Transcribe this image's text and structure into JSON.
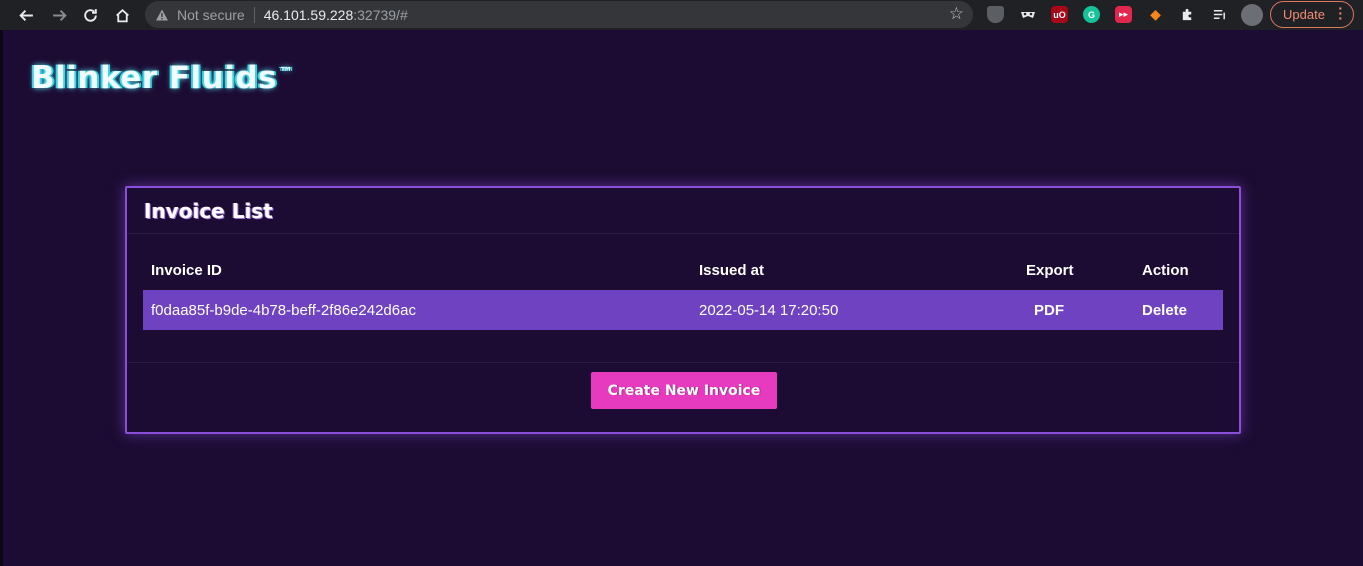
{
  "browser": {
    "not_secure_label": "Not secure",
    "url_host": "46.101.59.228",
    "url_rest": ":32739/#",
    "update_label": "Update",
    "extensions": [
      "shield-extension-icon",
      "mask-extension-icon",
      "ublock-icon",
      "grammarly-icon",
      "youtube-extension-icon",
      "metamask-fox-icon",
      "puzzle-extensions-icon",
      "reading-list-icon",
      "profile-avatar"
    ]
  },
  "app": {
    "logo_text": "Blinker Fluids",
    "logo_tm": "™"
  },
  "invoice_card": {
    "title": "Invoice List",
    "headers": {
      "invoice_id": "Invoice ID",
      "issued_at": "Issued at",
      "export": "Export",
      "action": "Action"
    },
    "rows": [
      {
        "invoice_id": "f0daa85f-b9de-4b78-beff-2f86e242d6ac",
        "issued_at": "2022-05-14 17:20:50",
        "export": "PDF",
        "action": "Delete"
      }
    ],
    "create_button": "Create New Invoice"
  },
  "colors": {
    "page_background": "#1c0c33",
    "card_border": "#8a4fd8",
    "row_highlight": "#6e42c1",
    "create_button": "#e63bbf",
    "logo_glow": "#34d6e6"
  }
}
